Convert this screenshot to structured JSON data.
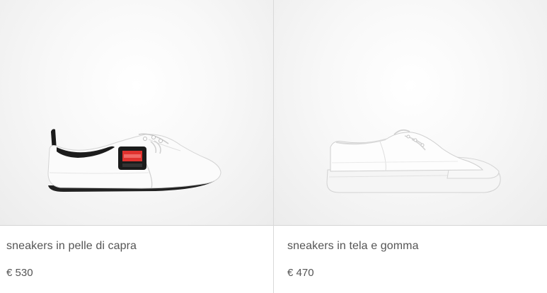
{
  "products": [
    {
      "name": "sneakers in pelle di capra",
      "price": "€ 530",
      "image": "white-leather-sneaker-with-red-patch"
    },
    {
      "name": "sneakers in tela e gomma",
      "price": "€ 470",
      "image": "white-canvas-sneaker"
    }
  ],
  "colors": {
    "background": "#ffffff",
    "text": "#555555",
    "divider": "#d9d9d9",
    "patch_red": "#e0322e"
  }
}
